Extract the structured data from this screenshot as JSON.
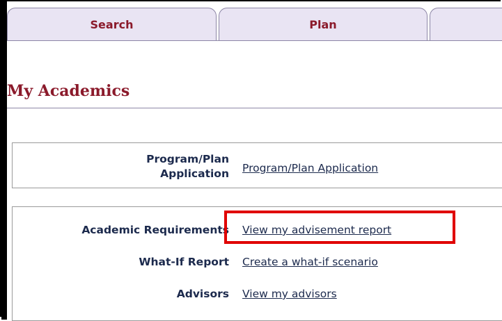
{
  "tabs": [
    {
      "label": "Search"
    },
    {
      "label": "Plan"
    },
    {
      "label": ""
    }
  ],
  "page_title": "My Academics",
  "program_section": {
    "label_line1": "Program/Plan",
    "label_line2": "Application",
    "link": "Program/Plan Application"
  },
  "requirements_section": {
    "rows": [
      {
        "label": "Academic Requirements",
        "link": "View my advisement report"
      },
      {
        "label": "What-If Report",
        "link": "Create a what-if scenario"
      },
      {
        "label": "Advisors",
        "link": "View my advisors"
      }
    ]
  },
  "colors": {
    "accent": "#8b1a2b",
    "text": "#1c2a4d",
    "tab_bg": "#e9e4f3",
    "highlight": "#e00000"
  }
}
